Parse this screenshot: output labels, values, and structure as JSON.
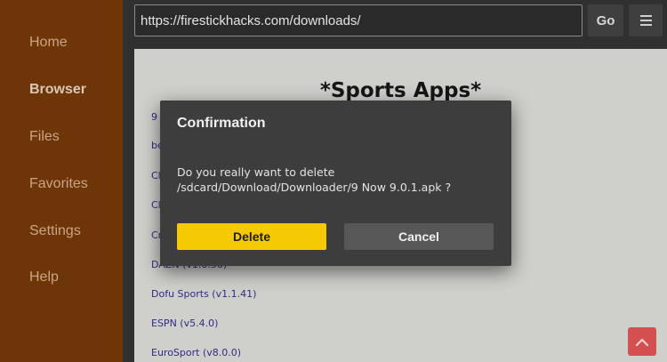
{
  "sidebar": {
    "items": [
      {
        "label": "Home",
        "active": false
      },
      {
        "label": "Browser",
        "active": true
      },
      {
        "label": "Files",
        "active": false
      },
      {
        "label": "Favorites",
        "active": false
      },
      {
        "label": "Settings",
        "active": false
      },
      {
        "label": "Help",
        "active": false
      }
    ]
  },
  "toolbar": {
    "url_value": "https://firestickhacks.com/downloads/",
    "go_label": "Go",
    "menu_icon": "hamburger-menu-icon"
  },
  "webpage": {
    "heading": "*Sports Apps*",
    "links": [
      "9",
      "be",
      "Cl",
      "Cl",
      "Cr",
      "DAZN (v1.0.58)",
      "Dofu Sports (v1.1.41)",
      "ESPN (v5.4.0)",
      "EuroSport (v8.0.0)"
    ]
  },
  "dialog": {
    "title": "Confirmation",
    "message": "Do you really want to delete /sdcard/Download/Downloader/9 Now 9.0.1.apk ?",
    "delete_label": "Delete",
    "cancel_label": "Cancel"
  },
  "colors": {
    "sidebar_bg": "#6e3607",
    "accent_yellow": "#f6c905",
    "scroll_button": "#d44f4f"
  },
  "scroll_top_icon": "chevron-up-icon"
}
